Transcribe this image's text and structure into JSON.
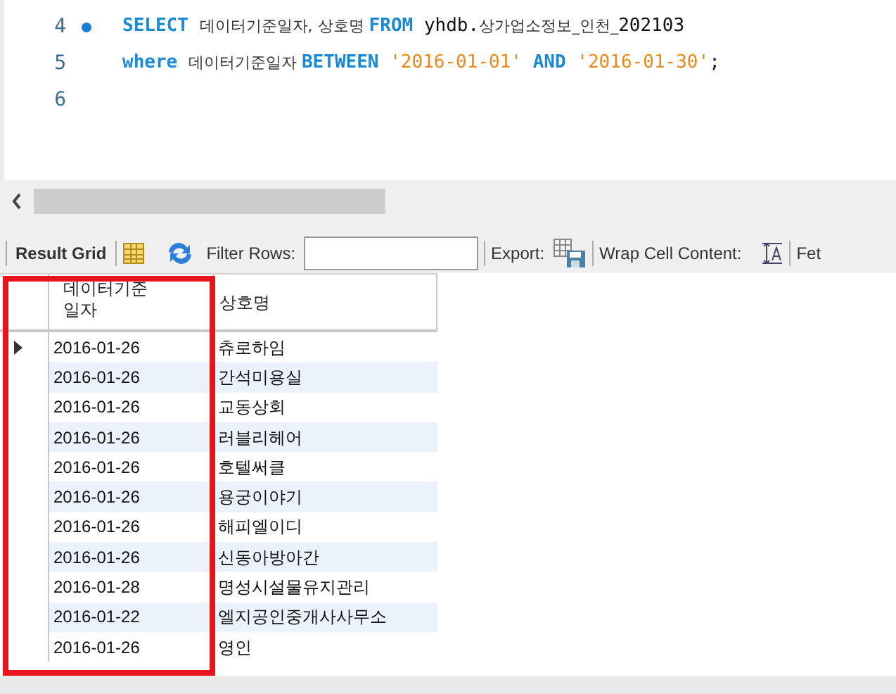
{
  "editor": {
    "lines": [
      {
        "number": "4",
        "breakpoint": true,
        "tokens": [
          {
            "kind": "keyword",
            "text": "SELECT "
          },
          {
            "kind": "ident",
            "text": "데이터기준일자, 상호명 "
          },
          {
            "kind": "keyword",
            "text": "FROM "
          },
          {
            "kind": "plain",
            "text": "yhdb."
          },
          {
            "kind": "ident",
            "text": "상가업소정보_인천_"
          },
          {
            "kind": "plain",
            "text": "202103"
          }
        ]
      },
      {
        "number": "5",
        "breakpoint": false,
        "tokens": [
          {
            "kind": "keyword",
            "text": "where "
          },
          {
            "kind": "ident",
            "text": "데이터기준일자 "
          },
          {
            "kind": "keyword",
            "text": "BETWEEN "
          },
          {
            "kind": "string",
            "text": "'2016-01-01'"
          },
          {
            "kind": "keyword",
            "text": " AND "
          },
          {
            "kind": "string",
            "text": "'2016-01-30'"
          },
          {
            "kind": "plain",
            "text": ";"
          }
        ]
      },
      {
        "number": "6",
        "breakpoint": false
      }
    ]
  },
  "toolbar": {
    "result_grid": "Result Grid",
    "filter_label": "Filter Rows:",
    "export_label": "Export:",
    "wrap_label": "Wrap Cell Content:",
    "fetch_label": "Fet"
  },
  "grid": {
    "columns": [
      "데이터기준\n일자",
      "상호명"
    ],
    "rows": [
      {
        "selected": true,
        "date": "2016-01-26",
        "name": "츄로하임"
      },
      {
        "selected": false,
        "date": "2016-01-26",
        "name": "간석미용실"
      },
      {
        "selected": false,
        "date": "2016-01-26",
        "name": "교동상회"
      },
      {
        "selected": false,
        "date": "2016-01-26",
        "name": "러블리헤어"
      },
      {
        "selected": false,
        "date": "2016-01-26",
        "name": "호텔써클"
      },
      {
        "selected": false,
        "date": "2016-01-26",
        "name": "용궁이야기"
      },
      {
        "selected": false,
        "date": "2016-01-26",
        "name": "해피엘이디"
      },
      {
        "selected": false,
        "date": "2016-01-26",
        "name": "신동아방아간"
      },
      {
        "selected": false,
        "date": "2016-01-28",
        "name": "명성시설물유지관리"
      },
      {
        "selected": false,
        "date": "2016-01-22",
        "name": "엘지공인중개사사무소"
      },
      {
        "selected": false,
        "date": "2016-01-26",
        "name": "영인"
      }
    ]
  }
}
